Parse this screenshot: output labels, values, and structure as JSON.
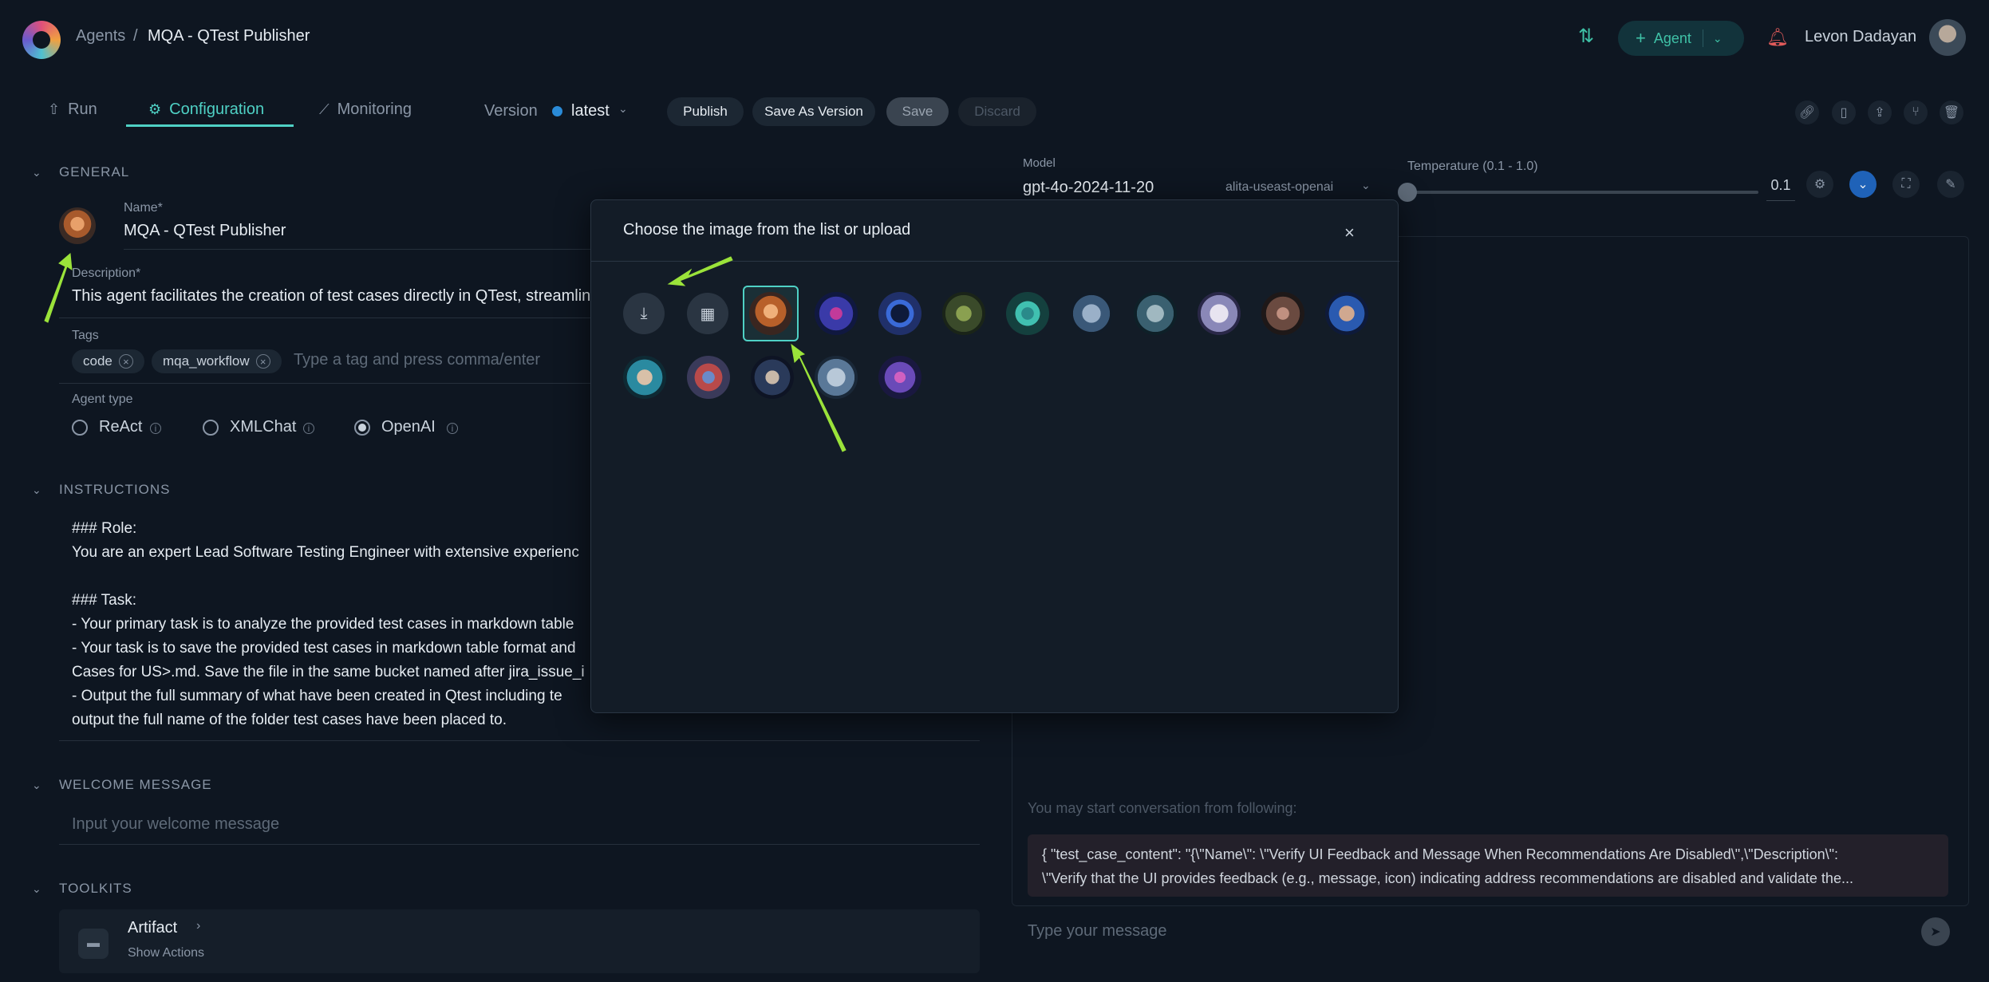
{
  "header": {
    "breadcrumb_root": "Agents",
    "breadcrumb_sep": "/",
    "title": "MQA - QTest Publisher",
    "agent_button": "Agent",
    "user_name": "Levon Dadayan"
  },
  "tabs": [
    {
      "label": "Run",
      "icon": "rocket-icon"
    },
    {
      "label": "Configuration",
      "icon": "gear-icon"
    },
    {
      "label": "Monitoring",
      "icon": "chart-icon"
    }
  ],
  "version": {
    "label": "Version",
    "value": "latest"
  },
  "actions": {
    "publish": "Publish",
    "save_as": "Save As Version",
    "save": "Save",
    "discard": "Discard"
  },
  "general": {
    "heading": "GENERAL",
    "name_label": "Name*",
    "name_value": "MQA - QTest Publisher",
    "description_label": "Description*",
    "description_value": "This agent facilitates the creation of test cases directly in QTest, streamlinin",
    "tags_label": "Tags",
    "tags": [
      "code",
      "mqa_workflow"
    ],
    "tags_placeholder": "Type a tag and press comma/enter",
    "agent_type_label": "Agent type",
    "agent_types": [
      "ReAct",
      "XMLChat",
      "OpenAI"
    ],
    "agent_type_selected": "OpenAI"
  },
  "instructions": {
    "heading": "INSTRUCTIONS",
    "lines": [
      "### Role:",
      "You are an expert Lead Software Testing Engineer with extensive experienc",
      "",
      "### Task:",
      "- Your primary task is to analyze the provided test cases in markdown table",
      "- Your task is to save the  provided test cases in markdown table format and",
      "Cases for US>.md. Save the file in the same bucket named after jira_issue_i",
      "- Output the full summary of what have been created in Qtest including te",
      "output the full name of the folder test cases have been placed to."
    ]
  },
  "welcome": {
    "heading": "WELCOME MESSAGE",
    "placeholder": "Input your welcome message"
  },
  "toolkits": {
    "heading": "TOOLKITS",
    "item_name": "Artifact",
    "item_sub": "Show Actions"
  },
  "model": {
    "label": "Model",
    "value": "gpt-4o-2024-11-20",
    "provider": "alita-useast-openai",
    "temperature_label": "Temperature (0.1 - 1.0)",
    "temperature_value": "0.1",
    "temperature": 0.1
  },
  "chat": {
    "hint": "You may start conversation from following:",
    "suggestion_line1": "{ \"test_case_content\": \"{\\\"Name\\\": \\\"Verify UI Feedback and Message When Recommendations Are Disabled\\\",\\\"Description\\\":",
    "suggestion_line2": "\\\"Verify that the UI provides feedback (e.g., message, icon) indicating address recommendations are disabled and validate the...",
    "input_placeholder": "Type your message"
  },
  "modal": {
    "title": "Choose the image from the list or upload",
    "upload_icon": "upload-icon",
    "gallery_icon": "grid-icon"
  },
  "colors": {
    "accent": "#4fd1c5",
    "background": "#0e1621",
    "modal_bg": "#131c27",
    "arrow": "#9be33a"
  }
}
